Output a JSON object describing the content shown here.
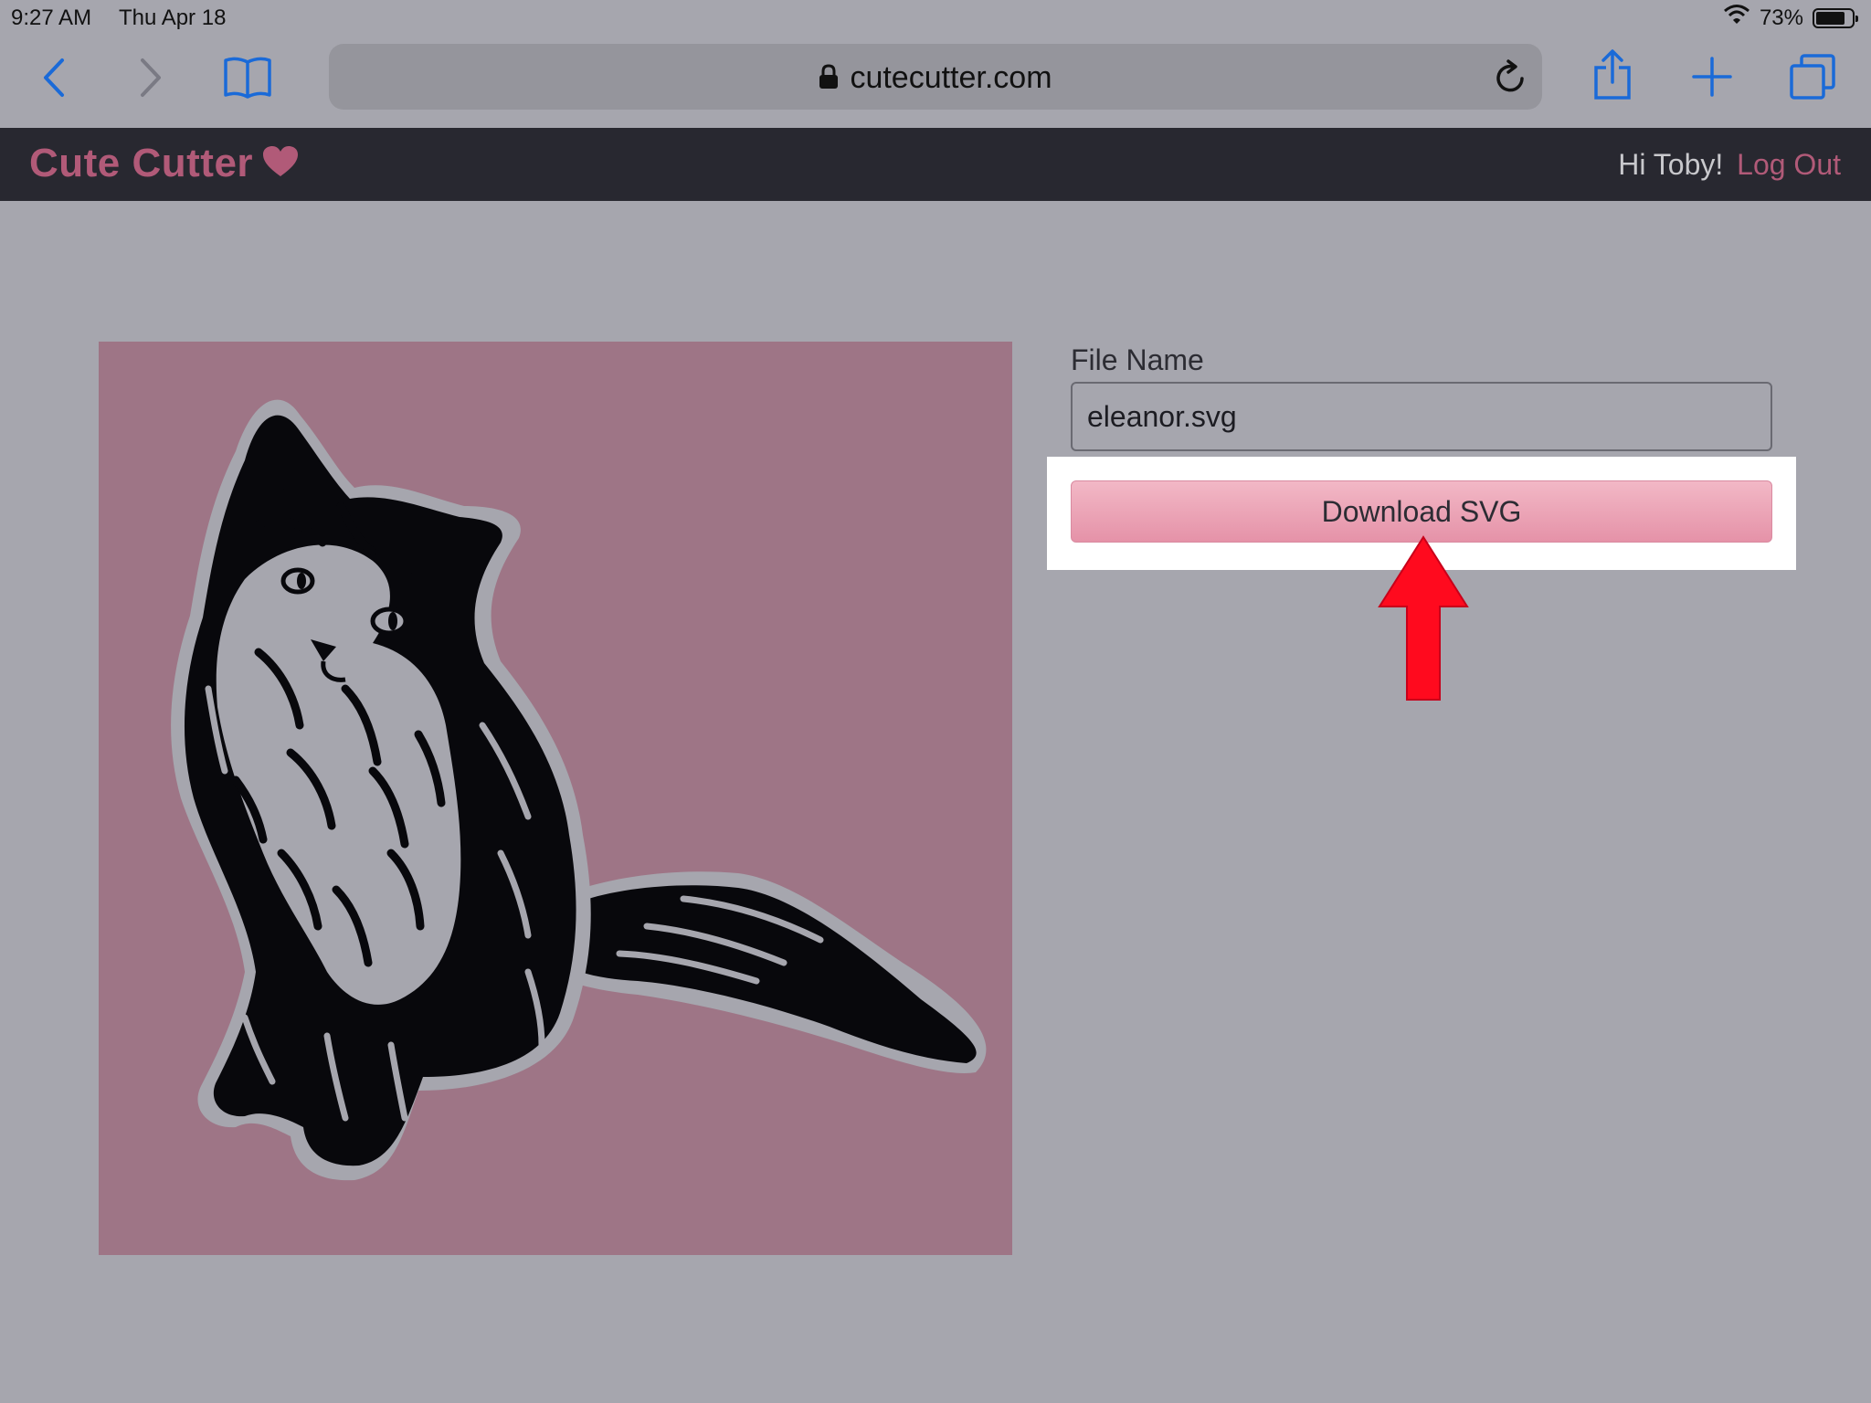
{
  "status_bar": {
    "time": "9:27 AM",
    "date": "Thu Apr 18",
    "battery_text": "73%",
    "battery_level": 0.73
  },
  "browser": {
    "url": "cutecutter.com",
    "icons": [
      "back-icon",
      "forward-icon",
      "bookmarks-icon",
      "lock-icon",
      "reload-icon",
      "share-icon",
      "new-tab-icon",
      "tabs-icon"
    ]
  },
  "header": {
    "brand": "Cute Cutter",
    "greeting": "Hi Toby!",
    "logout": "Log Out",
    "accent_color": "#b15a78"
  },
  "form": {
    "file_name_label": "File Name",
    "file_name_value": "eleanor.svg",
    "download_label": "Download SVG"
  },
  "preview": {
    "subject": "cat-illustration",
    "background_color": "#9e7586"
  }
}
